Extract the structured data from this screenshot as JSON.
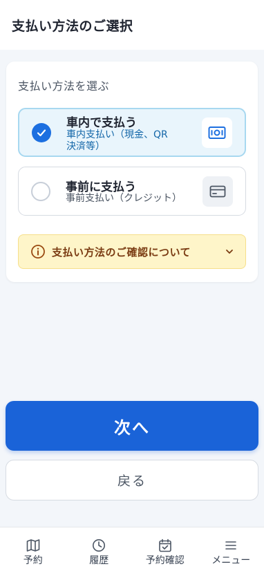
{
  "header": {
    "title": "支払い方法のご選択"
  },
  "card": {
    "section_label": "支払い方法を選ぶ",
    "options": [
      {
        "title": "車内で支払う",
        "subtitle": "車内支払い（現金、QR決済等）",
        "selected": true,
        "icon": "cash-icon"
      },
      {
        "title": "事前に支払う",
        "subtitle": "事前支払い（クレジット）",
        "selected": false,
        "icon": "credit-card-icon"
      }
    ],
    "notice": {
      "text": "支払い方法のご確認について",
      "icon": "info-icon",
      "expanded": false
    }
  },
  "actions": {
    "next_label": "次へ",
    "back_label": "戻る"
  },
  "tabbar": {
    "items": [
      {
        "label": "予約",
        "icon": "map-icon"
      },
      {
        "label": "履歴",
        "icon": "clock-icon"
      },
      {
        "label": "予約確認",
        "icon": "calendar-check-icon"
      },
      {
        "label": "メニュー",
        "icon": "menu-icon"
      }
    ]
  },
  "colors": {
    "primary": "#1a63d8",
    "selected_bg": "#e9f5fc",
    "notice_bg": "#fef5c9",
    "notice_text": "#7a3b12"
  }
}
